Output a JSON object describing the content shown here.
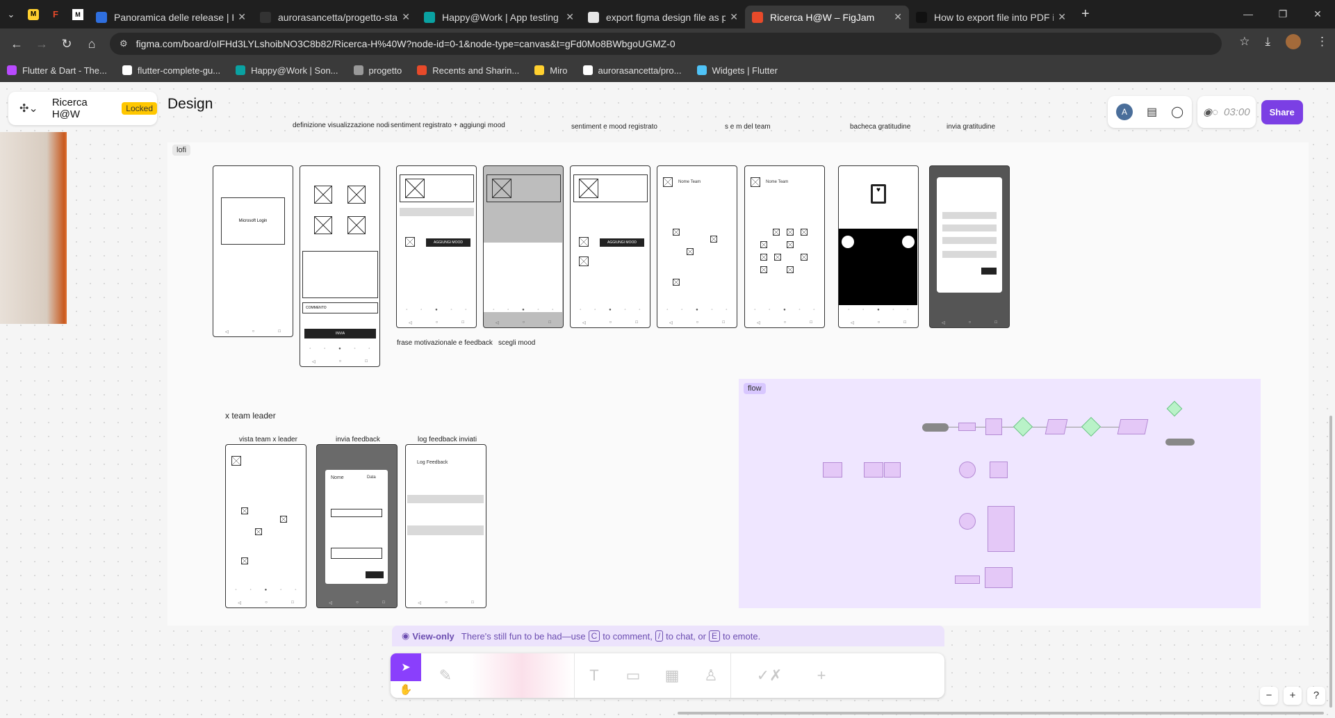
{
  "browser": {
    "tabs": [
      {
        "title": "Panoramica delle release | Happ",
        "fav_color": "#2f6fdf",
        "active": false
      },
      {
        "title": "aurorasancetta/progetto-stage",
        "fav_color": "#333333",
        "active": false
      },
      {
        "title": "Happy@Work | App testing",
        "fav_color": "#0aa2a2",
        "active": false
      },
      {
        "title": "export figma design file as pdf",
        "fav_color": "#e6e6e6",
        "active": false
      },
      {
        "title": "Ricerca H@W – FigJam",
        "fav_color": "#e84a2a",
        "active": true
      },
      {
        "title": "How to export file into PDF in F",
        "fav_color": "#111111",
        "active": false
      }
    ],
    "url": "figma.com/board/oIFHd3LYLshoibNO3C8b82/Ricerca-H%40W?node-id=0-1&node-type=canvas&t=gFd0Mo8BWbgoUGMZ-0",
    "bookmarks": [
      {
        "label": "Flutter & Dart - The...",
        "color": "#b94aff"
      },
      {
        "label": "flutter-complete-gu...",
        "color": "#ffffff"
      },
      {
        "label": "Happy@Work | Son...",
        "color": "#0aa2a2"
      },
      {
        "label": "progetto",
        "color": "#999999"
      },
      {
        "label": "Recents and Sharin...",
        "color": "#e84a2a"
      },
      {
        "label": "Miro",
        "color": "#ffd02f"
      },
      {
        "label": "aurorasancetta/pro...",
        "color": "#ffffff"
      },
      {
        "label": "Widgets | Flutter",
        "color": "#4fc3f7"
      }
    ]
  },
  "figjam": {
    "file_name": "Ricerca H@W",
    "locked_badge": "Locked",
    "page_title": "Design",
    "avatar_letter": "A",
    "timer": "03:00",
    "share_label": "Share",
    "view_only_label": "View-only",
    "view_only_text_1": "There's still fun to be had—use",
    "key_c": "C",
    "view_only_text_2": "to comment,",
    "key_slash": "/",
    "view_only_text_3": "to chat, or",
    "key_e": "E",
    "view_only_text_4": "to emote."
  },
  "canvas": {
    "lofi_section_label": "lofi",
    "flow_section_label": "flow",
    "frame_labels": {
      "definizione": "definizione visualizzazione nodi",
      "sentiment_reg": "sentiment registrato + aggiungi mood",
      "sentiment_mood": "sentiment e mood registrato",
      "sem_team": "s e m del team",
      "bacheca": "bacheca gratitudine",
      "invia_grat": "invia gratitudine",
      "frase": "frase motivazionale e feedback",
      "scegli": "scegli mood",
      "team_leader_heading": "x team leader",
      "vista_team": "vista team x leader",
      "invia_feedback": "invia feedback",
      "log_feedback": "log feedback inviati"
    },
    "wire_text": {
      "microsoft_login": "Microsoft Login",
      "commento": "COMMENTO",
      "invia": "INVIA",
      "aggiungi_mood": "AGGIUNGI MOOD",
      "nome_team": "Nome Team",
      "log_feedback_title": "Log Feedback",
      "nome": "Nome",
      "data": "Data"
    }
  },
  "colors": {
    "accent": "#8a3ffc",
    "share": "#7b3fe4",
    "locked": "#ffc700",
    "flow_bg": "#efe6ff",
    "flow_node": "#e4c8f7",
    "flow_decision": "#b9f2c8"
  }
}
